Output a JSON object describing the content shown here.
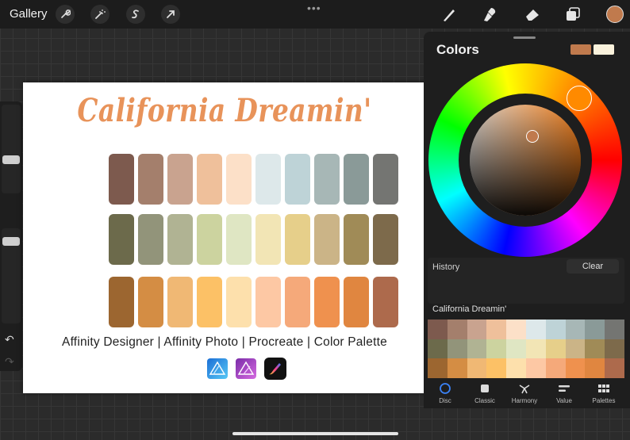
{
  "topbar": {
    "gallery_label": "Gallery",
    "left_tools": [
      "wrench-icon",
      "magic-wand-icon",
      "selection-s-icon",
      "transform-arrow-icon"
    ],
    "right_tools": [
      "brush-icon",
      "smudge-icon",
      "eraser-icon",
      "layers-icon"
    ],
    "current_color": "#c07a4d"
  },
  "artwork": {
    "title": "California Dreamin'",
    "caption": "Affinity Designer | Affinity Photo | Procreate | Color Palette",
    "logos": [
      "affinity-designer-logo",
      "affinity-photo-logo",
      "procreate-logo"
    ],
    "swatch_rows": [
      [
        "#7d5a4e",
        "#a47f6c",
        "#c9a38f",
        "#efc09b",
        "#fce0c8",
        "#dde8ea",
        "#bed3d7",
        "#a7b7b6",
        "#8a9a98",
        "#747572"
      ],
      [
        "#6c6a4b",
        "#92947a",
        "#b0b393",
        "#ccd39f",
        "#dfe6c3",
        "#f2e5b5",
        "#e6cf8a",
        "#cbb487",
        "#a08b57",
        "#7d6a4b"
      ],
      [
        "#9c6630",
        "#d48d44",
        "#f0b874",
        "#fcc166",
        "#fde0ac",
        "#fdc8a4",
        "#f5a97a",
        "#ef914e",
        "#e08640",
        "#ad6a4c"
      ]
    ]
  },
  "colors_panel": {
    "title": "Colors",
    "current_color": "#c07a4d",
    "previous_color": "#faf2dc",
    "history_label": "History",
    "clear_label": "Clear",
    "palette_name": "California Dreamin'",
    "tabs": [
      {
        "label": "Disc",
        "icon": "disc-icon",
        "active": true
      },
      {
        "label": "Classic",
        "icon": "classic-square-icon",
        "active": false
      },
      {
        "label": "Harmony",
        "icon": "harmony-icon",
        "active": false
      },
      {
        "label": "Value",
        "icon": "value-sliders-icon",
        "active": false
      },
      {
        "label": "Palettes",
        "icon": "palettes-grid-icon",
        "active": false
      }
    ]
  }
}
